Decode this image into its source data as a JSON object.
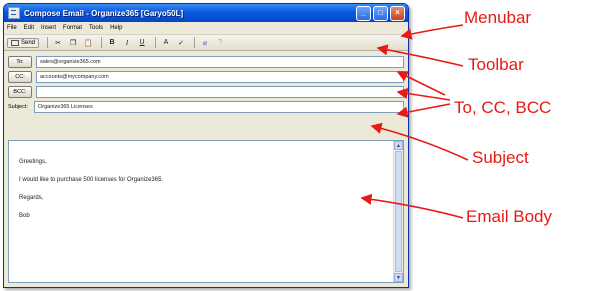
{
  "window": {
    "title": "Compose Email - Organize365  [Garyo50L]",
    "controls": {
      "minimize": "_",
      "maximize": "□",
      "close": "×"
    }
  },
  "menubar": {
    "items": [
      "File",
      "Edit",
      "Insert",
      "Format",
      "Tools",
      "Help"
    ]
  },
  "toolbar": {
    "send_label": "Send",
    "bold": "B",
    "italic": "I",
    "underline": "U",
    "font": "A",
    "clip": "⌀",
    "help": "?"
  },
  "fields": {
    "to_label": "To:",
    "to_value": "sales@organize365.com",
    "cc_label": "CC:",
    "cc_value": "accounts@mycompany.com",
    "bcc_label": "BCC:",
    "bcc_value": "",
    "subject_label": "Subject:",
    "subject_value": "Organize365 Licenses"
  },
  "body": {
    "lines": [
      "Greetings,",
      "I would like to purchase 500 licenses for Organize365.",
      "Regards,",
      "Bob"
    ]
  },
  "annotations": {
    "menubar": "Menubar",
    "toolbar": "Toolbar",
    "recipients": "To, CC, BCC",
    "subject": "Subject",
    "body": "Email Body",
    "color": "#e81a15"
  }
}
